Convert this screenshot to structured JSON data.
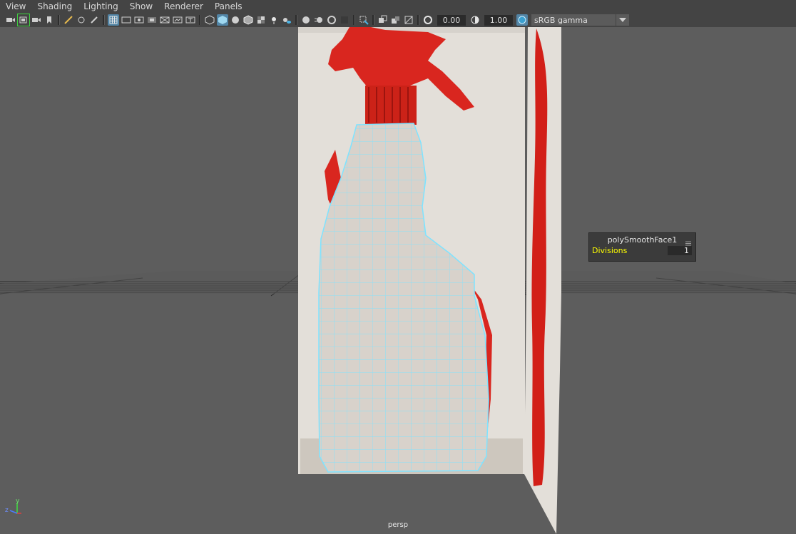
{
  "menu": [
    "View",
    "Shading",
    "Lighting",
    "Show",
    "Renderer",
    "Panels"
  ],
  "toolbar": {
    "exposure_value": "0.00",
    "gamma_value": "1.00",
    "color_space": "sRGB gamma"
  },
  "hud": {
    "title": "polySmoothFace1",
    "label": "Divisions",
    "value": "1"
  },
  "viewport": {
    "camera_label": "persp",
    "axis_y": "y",
    "axis_z": "z"
  }
}
